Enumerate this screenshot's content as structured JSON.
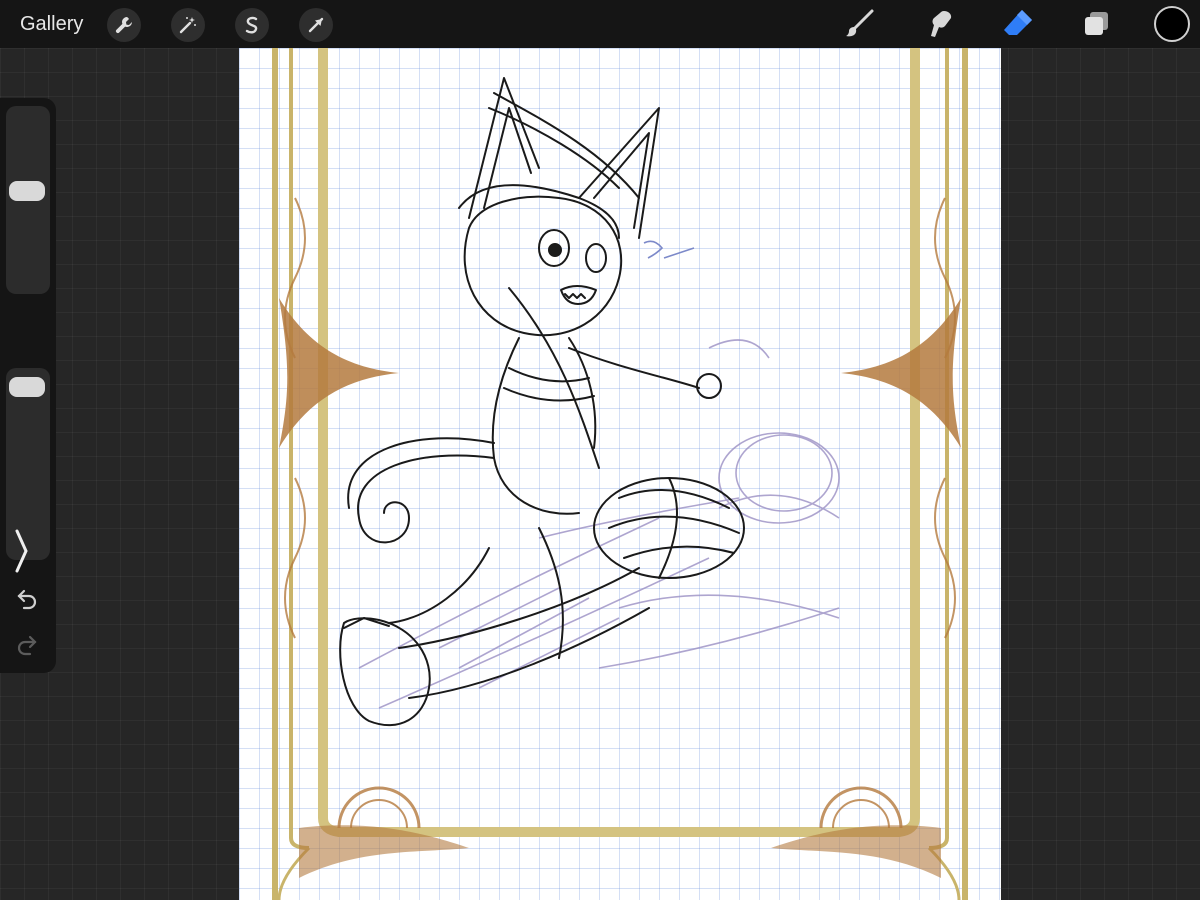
{
  "topbar": {
    "gallery_label": "Gallery",
    "left_tools": [
      "wrench-icon",
      "magic-wand-icon",
      "selection-icon",
      "arrow-transform-icon"
    ],
    "right_tools": [
      "brush-icon",
      "smudge-icon",
      "eraser-icon",
      "layers-icon"
    ],
    "active_tool": "eraser-icon",
    "accent_color": "#2f7df6",
    "current_color": "#000000"
  },
  "sidebar": {
    "controls": [
      "brush-size-slider",
      "modify-button",
      "opacity-slider",
      "undo-icon",
      "redo-icon"
    ]
  },
  "canvas": {
    "background": "#ffffff",
    "grid_color": "#8faee0",
    "frame_color": "#c9b46a",
    "ornament_color": "#b47a3e",
    "lineart_color": "#1a1a1a",
    "sketch_color": "#9a8fc4"
  }
}
